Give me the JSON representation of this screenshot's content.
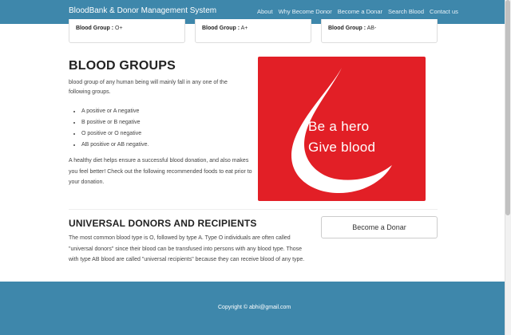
{
  "app": {
    "brand": "BloodBank & Donor Management System",
    "nav": [
      "About",
      "Why Become Donor",
      "Become a Donar",
      "Search Blood",
      "Contact us"
    ]
  },
  "cards": [
    {
      "label": "Blood Group :",
      "value": "O+"
    },
    {
      "label": "Blood Group :",
      "value": "A+"
    },
    {
      "label": "Blood Group :",
      "value": "AB-"
    }
  ],
  "blood_groups": {
    "title": "BLOOD GROUPS",
    "intro": "blood group of any human being will mainly fall in any one of the following groups.",
    "list": [
      "A positive or A negative",
      "B positive or B negative",
      "O positive or O negative",
      "AB positive or AB negative."
    ],
    "diet": "A healthy diet helps ensure a successful blood donation, and also makes you feel better! Check out the following recommended foods to eat prior to your donation."
  },
  "hero": {
    "line1": "Be a hero",
    "line2": "Give blood"
  },
  "universal": {
    "title": "UNIVERSAL DONORS AND RECIPIENTS",
    "text": "The most common blood type is O, followed by type A. Type O individuals are often called \"universal donors\" since their blood can be transfused into persons with any blood type. Those with type AB blood are called \"universal recipients\" because they can receive blood of any type."
  },
  "cta": {
    "button": "Become a Donar"
  },
  "footer": {
    "copyright": "Copyright © abhi@gmail.com"
  },
  "colors": {
    "primary": "#3e87ab",
    "hero_red": "#e21f26"
  }
}
